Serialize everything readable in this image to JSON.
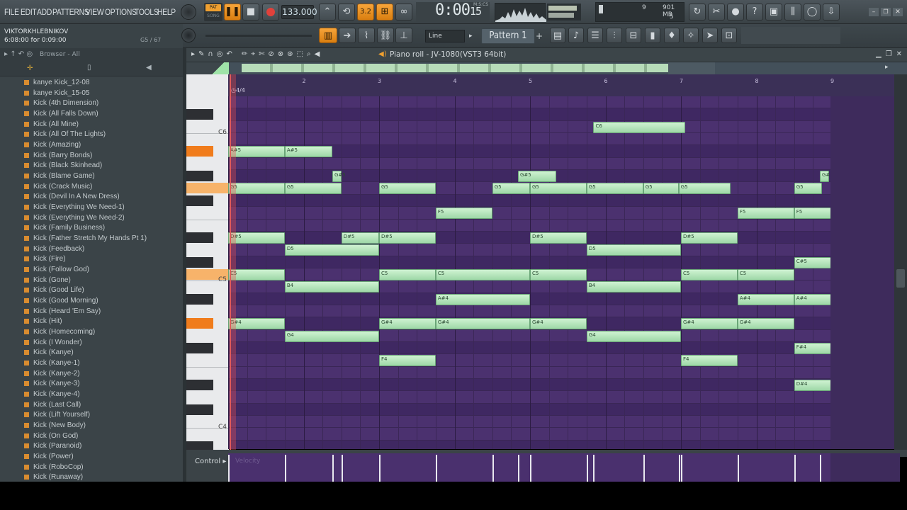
{
  "menu": [
    "FILE",
    "EDIT",
    "ADD",
    "PATTERNS",
    "VIEW",
    "OPTIONS",
    "TOOLS",
    "HELP"
  ],
  "transport": {
    "mode_pat": "PAT",
    "mode_song": "SONG",
    "tempo": "133.000",
    "time": "0:00",
    "time_sub": "15",
    "time_unit": "M:S:CS"
  },
  "resources": {
    "voices": "9",
    "memory": "901 MB",
    "cpu": "5"
  },
  "hint_bar": {
    "user": "VIKTORKHLEBNIKOV",
    "time_text": "6:08:00 for 0:09:00",
    "note_info": "G5 / 67"
  },
  "snap": {
    "value": "Line"
  },
  "pattern": {
    "name": "Pattern 1"
  },
  "browser": {
    "title": "Browser - All",
    "items": [
      "kanye Kick_12-08",
      "kanye Kick_15-05",
      "Kick (4th Dimension)",
      "Kick (All Falls Down)",
      "Kick (All Mine)",
      "Kick (All Of The Lights)",
      "Kick (Amazing)",
      "Kick (Barry Bonds)",
      "Kick (Black Skinhead)",
      "Kick (Blame Game)",
      "Kick (Crack Music)",
      "Kick (Devil In A New Dress)",
      "Kick (Everything We Need-1)",
      "Kick (Everything We Need-2)",
      "Kick (Family Business)",
      "Kick (Father Stretch My Hands Pt 1)",
      "Kick (Feedback)",
      "Kick (Fire)",
      "Kick (Follow God)",
      "Kick (Gone)",
      "Kick (Good Life)",
      "Kick (Good Morning)",
      "Kick (Heard 'Em Say)",
      "Kick (Hit)",
      "Kick (Homecoming)",
      "Kick (I Wonder)",
      "Kick (Kanye)",
      "Kick (Kanye-1)",
      "Kick (Kanye-2)",
      "Kick (Kanye-3)",
      "Kick (Kanye-4)",
      "Kick (Last Call)",
      "Kick (Lift Yourself)",
      "Kick (New Body)",
      "Kick (On God)",
      "Kick (Paranoid)",
      "Kick (Power)",
      "Kick (RoboCop)",
      "Kick (Runaway)"
    ]
  },
  "piano_roll": {
    "title": "Piano roll - JV-1080(VST3 64bit)",
    "time_signature": "4/4",
    "bars": [
      "2",
      "3",
      "4",
      "5",
      "6",
      "7",
      "8",
      "9"
    ],
    "key_labels": {
      "c6": "C6",
      "c5": "C5",
      "c4": "C4"
    },
    "notes": [
      {
        "label": "C6",
        "pitch": 84,
        "start": 5.84,
        "end": 7.06
      },
      {
        "label": "A#5",
        "pitch": 82,
        "start": 1.0,
        "end": 1.75
      },
      {
        "label": "A#5",
        "pitch": 82,
        "start": 1.75,
        "end": 2.38
      },
      {
        "label": "G#5",
        "pitch": 80,
        "start": 2.38,
        "end": 2.5
      },
      {
        "label": "G#5",
        "pitch": 80,
        "start": 4.84,
        "end": 5.35
      },
      {
        "label": "G#5",
        "pitch": 80,
        "start": 8.84,
        "end": 8.96
      },
      {
        "label": "G5",
        "pitch": 79,
        "start": 1.0,
        "end": 1.75
      },
      {
        "label": "G5",
        "pitch": 79,
        "start": 1.75,
        "end": 2.5
      },
      {
        "label": "G5",
        "pitch": 79,
        "start": 3.0,
        "end": 3.75
      },
      {
        "label": "G5",
        "pitch": 79,
        "start": 4.5,
        "end": 5.0
      },
      {
        "label": "G5",
        "pitch": 79,
        "start": 5.0,
        "end": 5.75
      },
      {
        "label": "G5",
        "pitch": 79,
        "start": 5.75,
        "end": 6.5
      },
      {
        "label": "G5",
        "pitch": 79,
        "start": 6.5,
        "end": 6.97
      },
      {
        "label": "G5",
        "pitch": 79,
        "start": 6.97,
        "end": 7.66
      },
      {
        "label": "G5",
        "pitch": 79,
        "start": 8.5,
        "end": 8.87
      },
      {
        "label": "F5",
        "pitch": 77,
        "start": 3.75,
        "end": 4.5
      },
      {
        "label": "F5",
        "pitch": 77,
        "start": 7.75,
        "end": 8.5
      },
      {
        "label": "F5",
        "pitch": 77,
        "start": 8.5,
        "end": 9.0
      },
      {
        "label": "D#5",
        "pitch": 75,
        "start": 1.0,
        "end": 1.75
      },
      {
        "label": "D#5",
        "pitch": 75,
        "start": 2.5,
        "end": 3.0
      },
      {
        "label": "D#5",
        "pitch": 75,
        "start": 3.0,
        "end": 3.75
      },
      {
        "label": "D#5",
        "pitch": 75,
        "start": 5.0,
        "end": 5.75
      },
      {
        "label": "D#5",
        "pitch": 75,
        "start": 7.0,
        "end": 7.75
      },
      {
        "label": "D5",
        "pitch": 74,
        "start": 1.75,
        "end": 3.0
      },
      {
        "label": "D5",
        "pitch": 74,
        "start": 5.75,
        "end": 7.0
      },
      {
        "label": "C#5",
        "pitch": 73,
        "start": 8.5,
        "end": 9.0
      },
      {
        "label": "C5",
        "pitch": 72,
        "start": 1.0,
        "end": 1.75
      },
      {
        "label": "C5",
        "pitch": 72,
        "start": 3.0,
        "end": 3.75
      },
      {
        "label": "C5",
        "pitch": 72,
        "start": 3.75,
        "end": 5.0
      },
      {
        "label": "C5",
        "pitch": 72,
        "start": 5.0,
        "end": 5.75
      },
      {
        "label": "C5",
        "pitch": 72,
        "start": 7.0,
        "end": 7.75
      },
      {
        "label": "C5",
        "pitch": 72,
        "start": 7.75,
        "end": 8.5
      },
      {
        "label": "B4",
        "pitch": 71,
        "start": 1.75,
        "end": 3.0
      },
      {
        "label": "B4",
        "pitch": 71,
        "start": 5.75,
        "end": 7.0
      },
      {
        "label": "A#4",
        "pitch": 70,
        "start": 3.75,
        "end": 5.0
      },
      {
        "label": "A#4",
        "pitch": 70,
        "start": 7.75,
        "end": 8.5
      },
      {
        "label": "A#4",
        "pitch": 70,
        "start": 8.5,
        "end": 9.0
      },
      {
        "label": "G#4",
        "pitch": 68,
        "start": 1.0,
        "end": 1.75
      },
      {
        "label": "G#4",
        "pitch": 68,
        "start": 3.0,
        "end": 3.75
      },
      {
        "label": "G#4",
        "pitch": 68,
        "start": 3.75,
        "end": 5.0
      },
      {
        "label": "G#4",
        "pitch": 68,
        "start": 5.0,
        "end": 5.75
      },
      {
        "label": "G#4",
        "pitch": 68,
        "start": 7.0,
        "end": 7.75
      },
      {
        "label": "G#4",
        "pitch": 68,
        "start": 7.75,
        "end": 8.5
      },
      {
        "label": "G4",
        "pitch": 67,
        "start": 1.75,
        "end": 3.0
      },
      {
        "label": "G4",
        "pitch": 67,
        "start": 5.75,
        "end": 7.0
      },
      {
        "label": "F#4",
        "pitch": 66,
        "start": 8.5,
        "end": 9.0
      },
      {
        "label": "F4",
        "pitch": 65,
        "start": 3.0,
        "end": 3.75
      },
      {
        "label": "F4",
        "pitch": 65,
        "start": 7.0,
        "end": 7.75
      },
      {
        "label": "D#4",
        "pitch": 63,
        "start": 8.5,
        "end": 9.0
      }
    ]
  },
  "control": {
    "label": "Control",
    "target": "Velocity"
  },
  "icons": {
    "play": "pause-icon",
    "stop": "stop-icon",
    "record": "record-icon"
  }
}
